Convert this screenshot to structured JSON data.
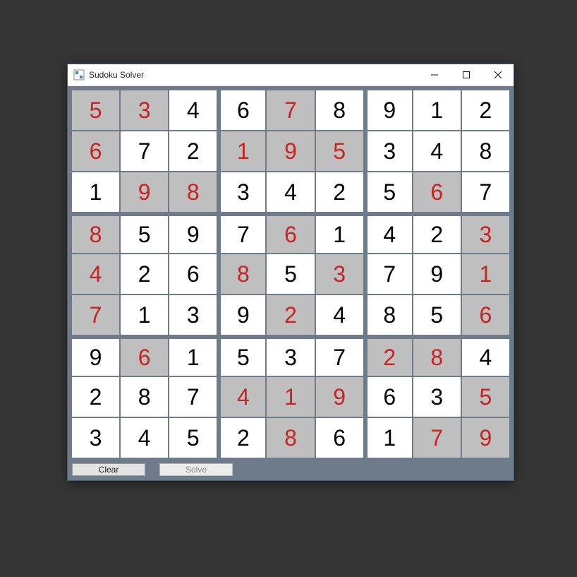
{
  "window": {
    "title": "Sudoku Solver"
  },
  "buttons": {
    "clear": "Clear",
    "solve": "Solve"
  },
  "icons": {
    "app": "app-icon",
    "minimize": "minimize-icon",
    "maximize": "maximize-icon",
    "close": "close-icon"
  },
  "grid": [
    [
      {
        "v": "5",
        "given": true
      },
      {
        "v": "3",
        "given": true
      },
      {
        "v": "4",
        "given": false
      },
      {
        "v": "6",
        "given": false
      },
      {
        "v": "7",
        "given": true
      },
      {
        "v": "8",
        "given": false
      },
      {
        "v": "9",
        "given": false
      },
      {
        "v": "1",
        "given": false
      },
      {
        "v": "2",
        "given": false
      }
    ],
    [
      {
        "v": "6",
        "given": true
      },
      {
        "v": "7",
        "given": false
      },
      {
        "v": "2",
        "given": false
      },
      {
        "v": "1",
        "given": true
      },
      {
        "v": "9",
        "given": true
      },
      {
        "v": "5",
        "given": true
      },
      {
        "v": "3",
        "given": false
      },
      {
        "v": "4",
        "given": false
      },
      {
        "v": "8",
        "given": false
      }
    ],
    [
      {
        "v": "1",
        "given": false
      },
      {
        "v": "9",
        "given": true
      },
      {
        "v": "8",
        "given": true
      },
      {
        "v": "3",
        "given": false
      },
      {
        "v": "4",
        "given": false
      },
      {
        "v": "2",
        "given": false
      },
      {
        "v": "5",
        "given": false
      },
      {
        "v": "6",
        "given": true
      },
      {
        "v": "7",
        "given": false
      }
    ],
    [
      {
        "v": "8",
        "given": true
      },
      {
        "v": "5",
        "given": false
      },
      {
        "v": "9",
        "given": false
      },
      {
        "v": "7",
        "given": false
      },
      {
        "v": "6",
        "given": true
      },
      {
        "v": "1",
        "given": false
      },
      {
        "v": "4",
        "given": false
      },
      {
        "v": "2",
        "given": false
      },
      {
        "v": "3",
        "given": true
      }
    ],
    [
      {
        "v": "4",
        "given": true
      },
      {
        "v": "2",
        "given": false
      },
      {
        "v": "6",
        "given": false
      },
      {
        "v": "8",
        "given": true
      },
      {
        "v": "5",
        "given": false
      },
      {
        "v": "3",
        "given": true
      },
      {
        "v": "7",
        "given": false
      },
      {
        "v": "9",
        "given": false
      },
      {
        "v": "1",
        "given": true
      }
    ],
    [
      {
        "v": "7",
        "given": true
      },
      {
        "v": "1",
        "given": false
      },
      {
        "v": "3",
        "given": false
      },
      {
        "v": "9",
        "given": false
      },
      {
        "v": "2",
        "given": true
      },
      {
        "v": "4",
        "given": false
      },
      {
        "v": "8",
        "given": false
      },
      {
        "v": "5",
        "given": false
      },
      {
        "v": "6",
        "given": true
      }
    ],
    [
      {
        "v": "9",
        "given": false
      },
      {
        "v": "6",
        "given": true
      },
      {
        "v": "1",
        "given": false
      },
      {
        "v": "5",
        "given": false
      },
      {
        "v": "3",
        "given": false
      },
      {
        "v": "7",
        "given": false
      },
      {
        "v": "2",
        "given": true
      },
      {
        "v": "8",
        "given": true
      },
      {
        "v": "4",
        "given": false
      }
    ],
    [
      {
        "v": "2",
        "given": false
      },
      {
        "v": "8",
        "given": false
      },
      {
        "v": "7",
        "given": false
      },
      {
        "v": "4",
        "given": true
      },
      {
        "v": "1",
        "given": true
      },
      {
        "v": "9",
        "given": true
      },
      {
        "v": "6",
        "given": false
      },
      {
        "v": "3",
        "given": false
      },
      {
        "v": "5",
        "given": true
      }
    ],
    [
      {
        "v": "3",
        "given": false
      },
      {
        "v": "4",
        "given": false
      },
      {
        "v": "5",
        "given": false
      },
      {
        "v": "2",
        "given": false
      },
      {
        "v": "8",
        "given": true
      },
      {
        "v": "6",
        "given": false
      },
      {
        "v": "1",
        "given": false
      },
      {
        "v": "7",
        "given": true
      },
      {
        "v": "9",
        "given": true
      }
    ]
  ]
}
